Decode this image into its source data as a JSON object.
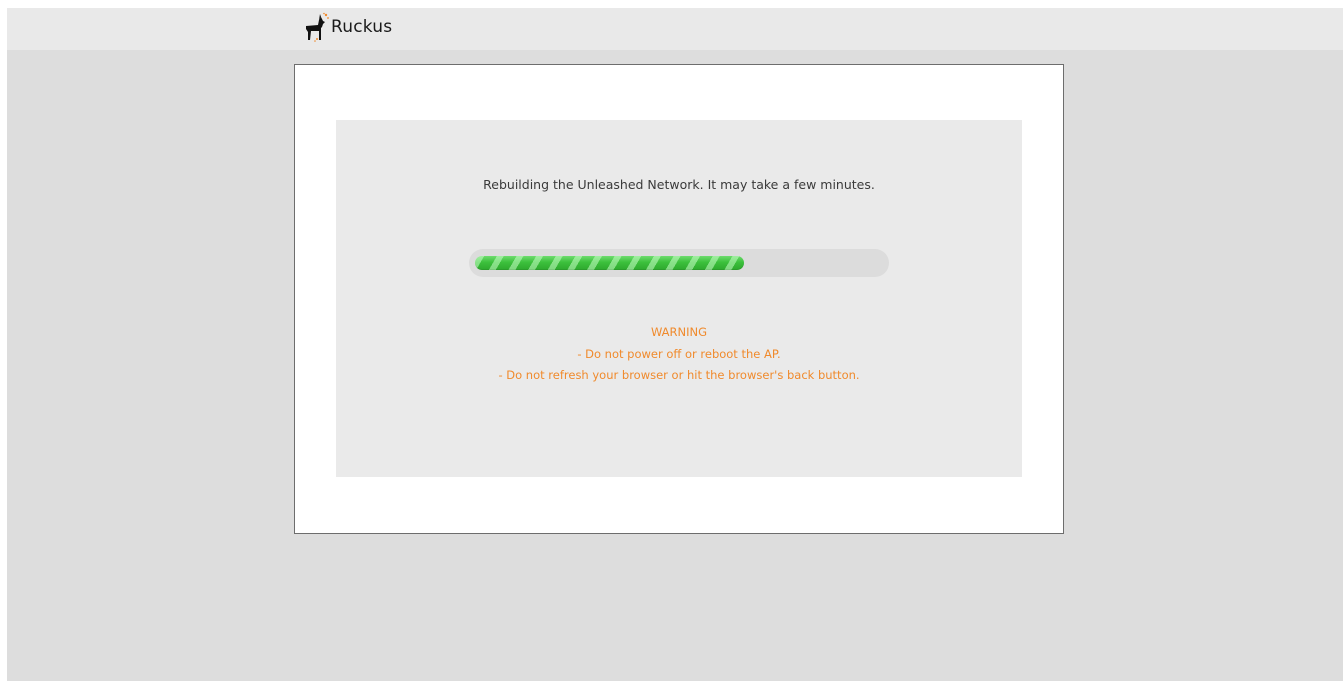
{
  "header": {
    "brand_name": "Ruckus",
    "logo_icon": "ruckus-dog-logo-icon"
  },
  "main": {
    "message": "Rebuilding the Unleashed Network. It may take a few minutes.",
    "progress": {
      "percent": 66,
      "color": "#3fbf3f",
      "track_color": "#dcdcdc"
    },
    "warning": {
      "title": "WARNING",
      "lines": [
        "- Do not power off or reboot the AP.",
        "- Do not refresh your browser or hit the browser's back button."
      ],
      "color": "#f08a2c"
    }
  }
}
